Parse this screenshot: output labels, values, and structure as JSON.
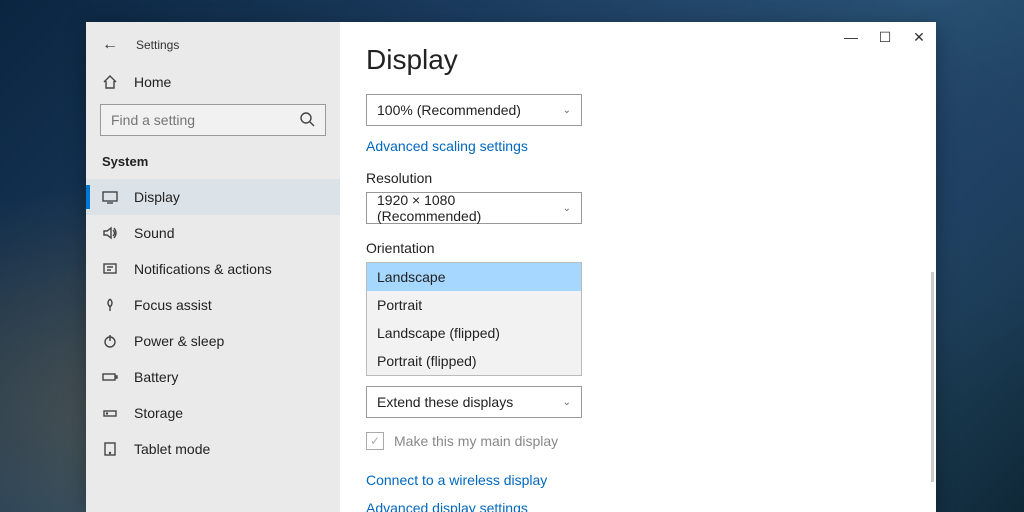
{
  "header": {
    "title": "Settings"
  },
  "sidebar": {
    "home": "Home",
    "search_placeholder": "Find a setting",
    "section": "System",
    "items": [
      "Display",
      "Sound",
      "Notifications & actions",
      "Focus assist",
      "Power & sleep",
      "Battery",
      "Storage",
      "Tablet mode"
    ]
  },
  "main": {
    "title": "Display",
    "scale_value": "100% (Recommended)",
    "advanced_scaling": "Advanced scaling settings",
    "resolution_label": "Resolution",
    "resolution_value": "1920 × 1080 (Recommended)",
    "orientation_label": "Orientation",
    "orientation_options": [
      "Landscape",
      "Portrait",
      "Landscape (flipped)",
      "Portrait (flipped)"
    ],
    "multiple_value": "Extend these displays",
    "main_display_checkbox": "Make this my main display",
    "wireless_link": "Connect to a wireless display",
    "advanced_display": "Advanced display settings"
  }
}
